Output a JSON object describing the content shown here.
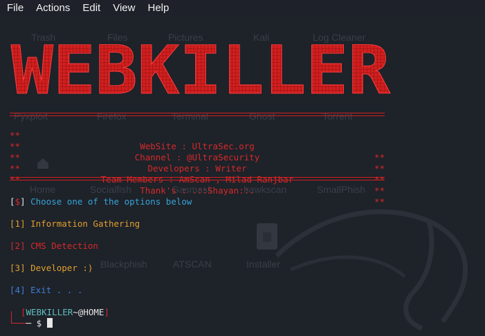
{
  "menu": {
    "items": [
      "File",
      "Actions",
      "Edit",
      "View",
      "Help"
    ]
  },
  "banner": {
    "text": "WEBKILLER",
    "color": "#d21f1f"
  },
  "info": {
    "stars": "**",
    "lines": [
      "WebSite : UltraSec.org",
      "Channel : @UltraSecurity",
      "Developers : Writer",
      "Team Members : AmScan , Milad Ranjbar",
      "Thank's : .::Shayan::."
    ]
  },
  "menu_options": {
    "prompt_tag": "$",
    "prompt_text": "Choose one of the options below",
    "options": [
      {
        "num": "1",
        "label": "Information Gathering"
      },
      {
        "num": "2",
        "label": "CMS Detection"
      },
      {
        "num": "3",
        "label": "Developer :)"
      },
      {
        "num": "4",
        "label": "Exit . . ."
      }
    ]
  },
  "shell_prompt": {
    "name": "WEBKILLER",
    "separator": "~",
    "location": "@HOME",
    "symbol": "$"
  },
  "desktop_ghost": {
    "row1": [
      "Trash",
      "Files",
      "Pictures",
      "Kali",
      "Log Cleaner"
    ],
    "row2": [
      "Home",
      "Socialfish",
      "Gasmask",
      "hawkscan",
      "SmallPhish"
    ],
    "row3": [
      "Blackphish",
      "ATSCAN",
      "Installer"
    ],
    "row0": [
      "Pyxploit",
      "Firefox",
      "Terminal",
      "Ghost",
      "Torrent"
    ]
  },
  "colors": {
    "background": "#1e2229",
    "red": "#d42a2a",
    "yellow": "#e0a030",
    "cyan": "#36a4d8",
    "blue": "#3d7fd6"
  }
}
